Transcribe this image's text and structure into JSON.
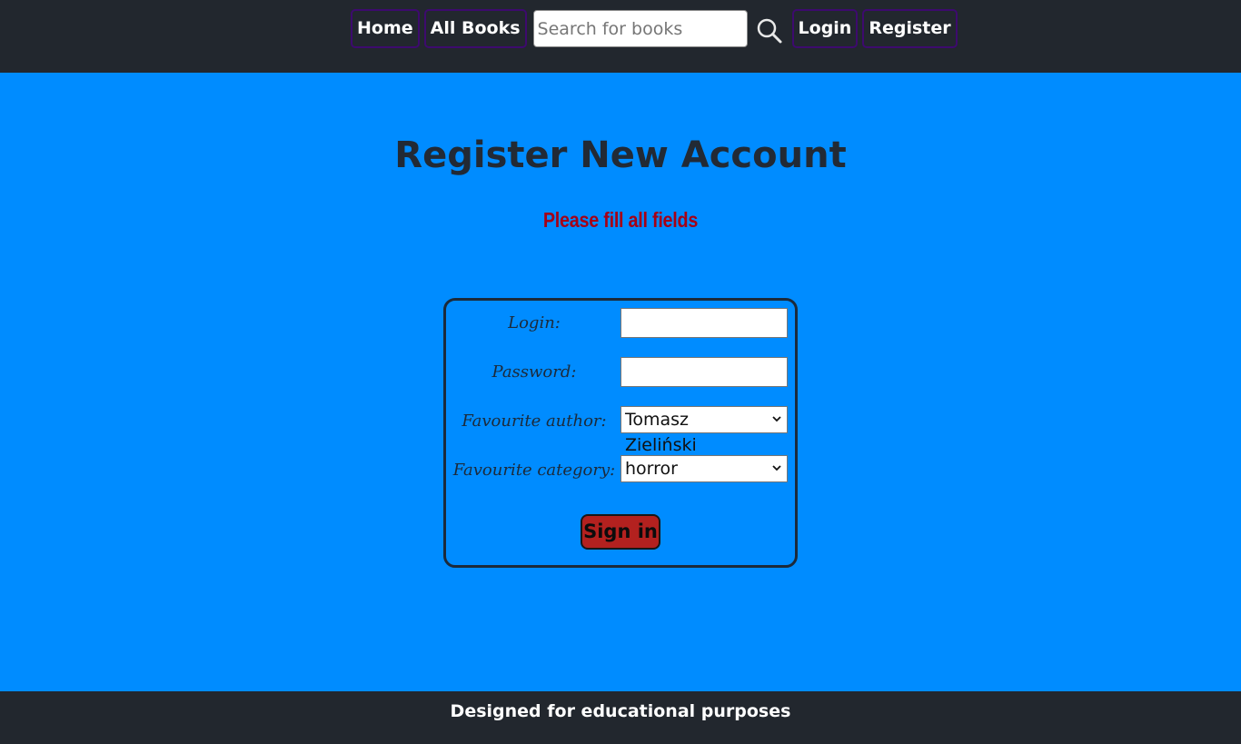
{
  "nav": {
    "home_label": "Home",
    "all_books_label": "All Books",
    "search_placeholder": "Search for books",
    "search_value": "",
    "login_label": "Login",
    "register_label": "Register"
  },
  "page": {
    "title": "Register New Account",
    "warning": "Please fill all fields"
  },
  "form": {
    "login_label": "Login:",
    "login_value": "",
    "password_label": "Password:",
    "password_value": "",
    "author_label": "Favourite author:",
    "author_selected": "Tomasz Zieliński",
    "category_label": "Favourite category:",
    "category_selected": "horror",
    "submit_label": "Sign in"
  },
  "footer": {
    "text": "Designed for educational purposes"
  },
  "colors": {
    "background": "#008cff",
    "bar": "#22272e",
    "nav_border": "#3d0a6e",
    "warning": "#a50016",
    "submit": "#b3211f"
  },
  "icons": {
    "search": "search-icon",
    "select_arrow": "chevron-down-icon"
  }
}
